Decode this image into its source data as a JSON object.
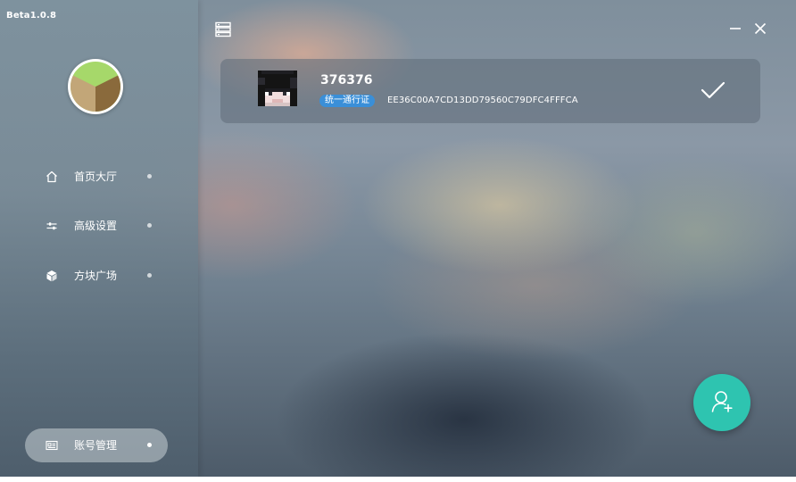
{
  "app": {
    "version": "Beta1.0.8"
  },
  "sidebar": {
    "items": [
      {
        "label": "首页大厅",
        "icon": "home-icon"
      },
      {
        "label": "高级设置",
        "icon": "sliders-icon"
      },
      {
        "label": "方块广场",
        "icon": "cube-icon"
      },
      {
        "label": "账号管理",
        "icon": "id-card-icon",
        "active": true
      }
    ]
  },
  "toolbar": {
    "server_icon": "server-list-icon",
    "minimize_icon": "minimize-icon",
    "close_icon": "close-icon"
  },
  "accounts": [
    {
      "name": "376376",
      "type_badge": "统一通行证",
      "uuid": "EE36C00A7CD13DD79560C79DFC4FFFCA",
      "selected": true
    }
  ],
  "actions": {
    "add_account_icon": "add-user-icon"
  },
  "colors": {
    "accent": "#2ec4b0",
    "badge": "#3a8fd8"
  }
}
